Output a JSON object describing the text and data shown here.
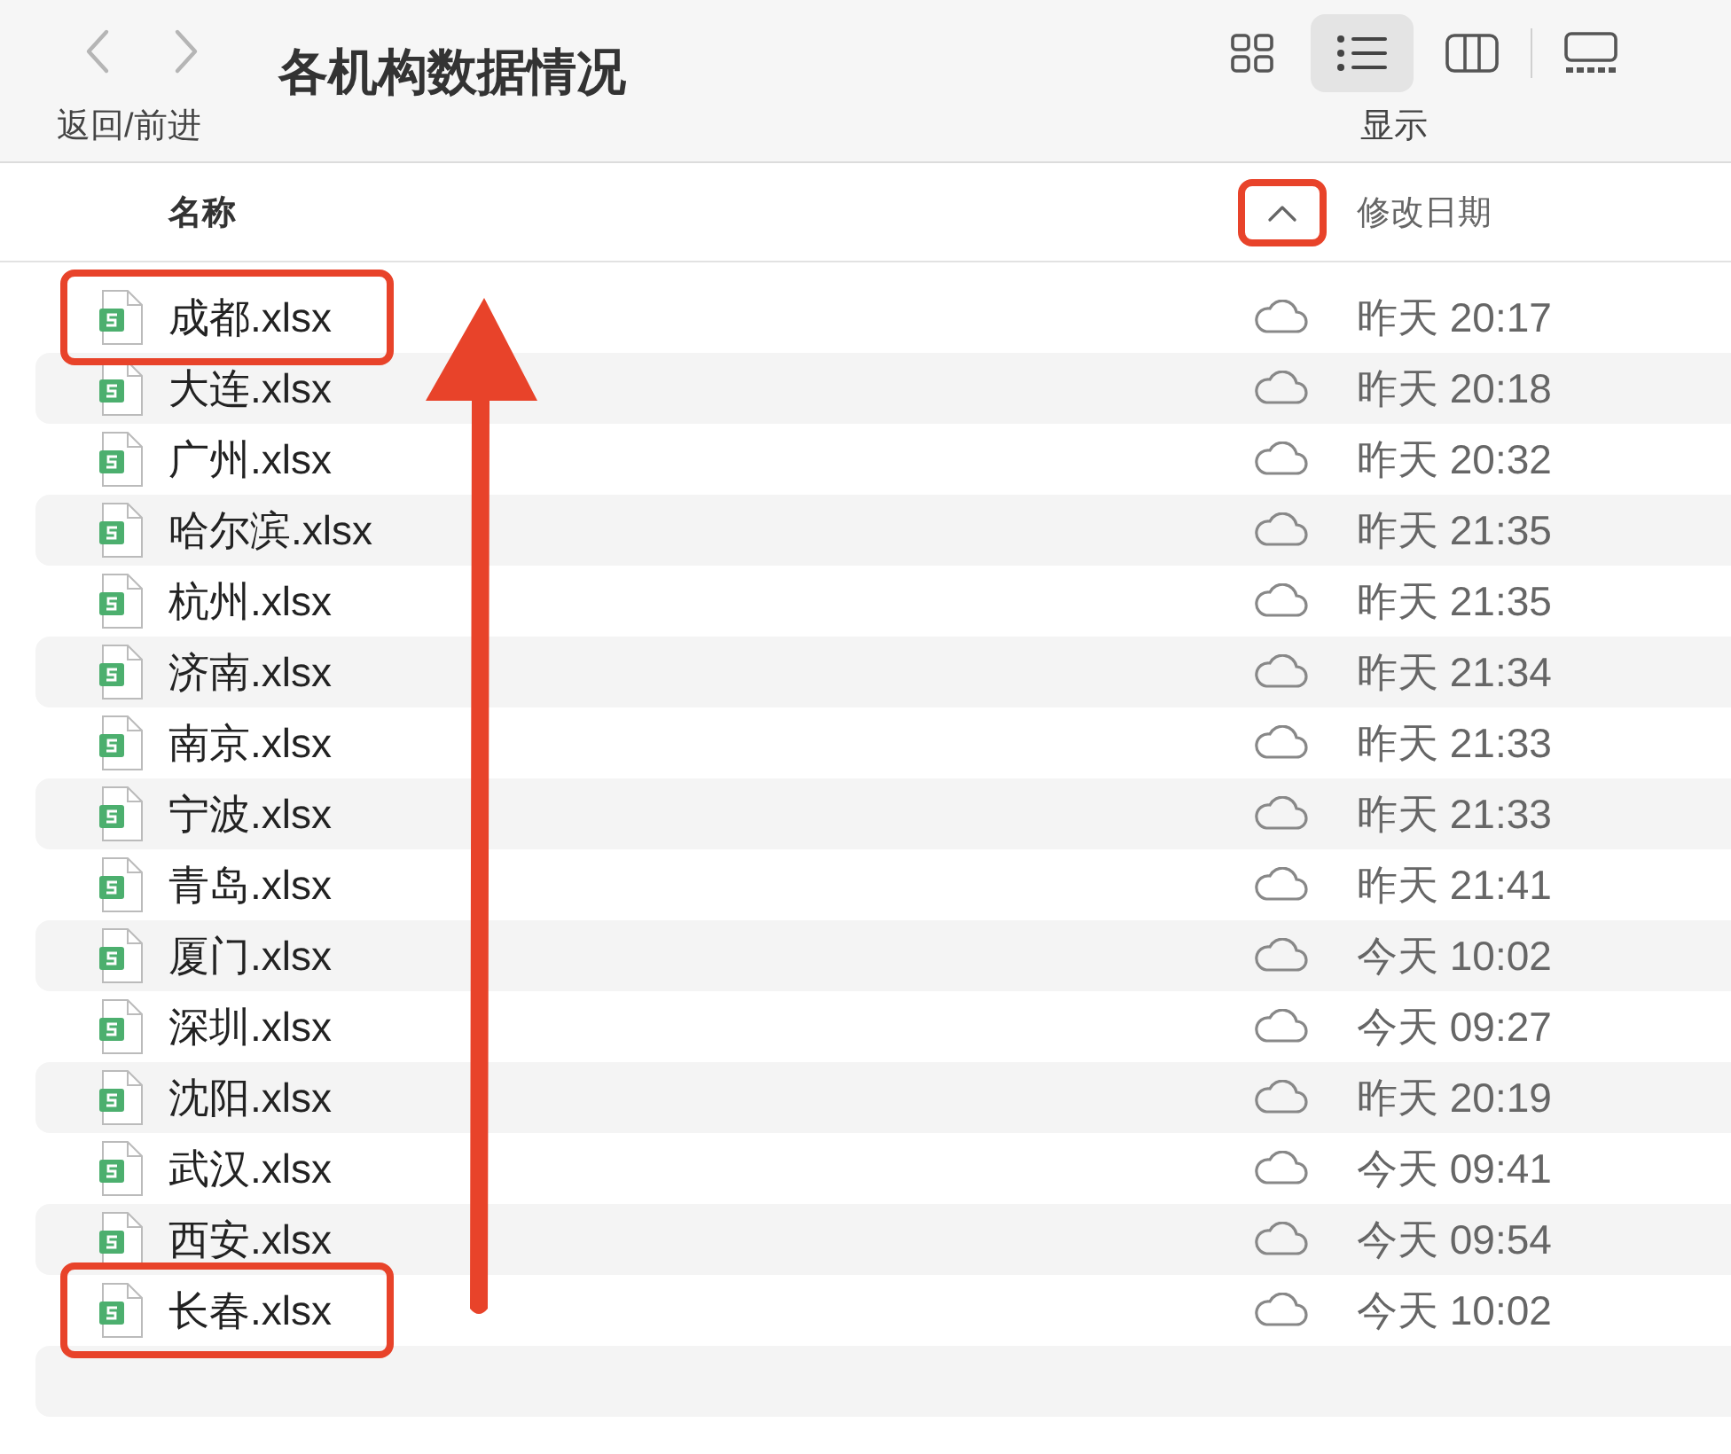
{
  "toolbar": {
    "title": "各机构数据情况",
    "nav_label": "返回/前进",
    "view_label": "显示",
    "views": [
      {
        "kind": "icons",
        "selected": false
      },
      {
        "kind": "list",
        "selected": true
      },
      {
        "kind": "columns",
        "selected": false
      },
      {
        "kind": "gallery",
        "selected": false
      }
    ]
  },
  "header": {
    "name": "名称",
    "date": "修改日期",
    "sort": {
      "ascending": true,
      "highlighted": true
    }
  },
  "rows": [
    {
      "name": "成都.xlsx",
      "date": "昨天 20:17",
      "highlighted": true
    },
    {
      "name": "大连.xlsx",
      "date": "昨天 20:18",
      "highlighted": false
    },
    {
      "name": "广州.xlsx",
      "date": "昨天 20:32",
      "highlighted": false
    },
    {
      "name": "哈尔滨.xlsx",
      "date": "昨天 21:35",
      "highlighted": false
    },
    {
      "name": "杭州.xlsx",
      "date": "昨天 21:35",
      "highlighted": false
    },
    {
      "name": "济南.xlsx",
      "date": "昨天 21:34",
      "highlighted": false
    },
    {
      "name": "南京.xlsx",
      "date": "昨天 21:33",
      "highlighted": false
    },
    {
      "name": "宁波.xlsx",
      "date": "昨天 21:33",
      "highlighted": false
    },
    {
      "name": "青岛.xlsx",
      "date": "昨天 21:41",
      "highlighted": false
    },
    {
      "name": "厦门.xlsx",
      "date": "今天 10:02",
      "highlighted": false
    },
    {
      "name": "深圳.xlsx",
      "date": "今天 09:27",
      "highlighted": false
    },
    {
      "name": "沈阳.xlsx",
      "date": "昨天 20:19",
      "highlighted": false
    },
    {
      "name": "武汉.xlsx",
      "date": "今天 09:41",
      "highlighted": false
    },
    {
      "name": "西安.xlsx",
      "date": "今天 09:54",
      "highlighted": false
    },
    {
      "name": "长春.xlsx",
      "date": "今天 10:02",
      "highlighted": true
    }
  ]
}
